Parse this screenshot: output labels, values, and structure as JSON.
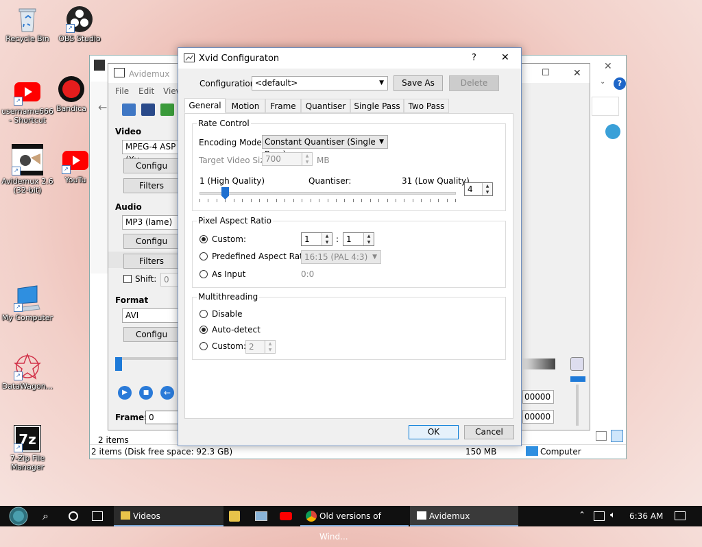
{
  "desktop": {
    "icons": [
      {
        "label": "Recycle Bin"
      },
      {
        "label": "OBS Studio"
      },
      {
        "label": "username666 - Shortcut"
      },
      {
        "label": "Bandica"
      },
      {
        "label": "Avidemux 2.6 (32-bit)"
      },
      {
        "label": "YouTu"
      },
      {
        "label": "My Computer"
      },
      {
        "label": "DataWagon..."
      },
      {
        "label": "7-Zip File Manager"
      }
    ]
  },
  "explorer": {
    "items_count": "2 items",
    "status_left": "2 items (Disk free space: 92.3 GB)",
    "status_size": "150 MB",
    "status_location": "Computer"
  },
  "avidemux": {
    "title": "Avidemux",
    "menu": [
      "File",
      "Edit",
      "View"
    ],
    "video_label": "Video",
    "video_codec": "MPEG-4 ASP (Xv",
    "configure": "Configu",
    "filters": "Filters",
    "audio_label": "Audio",
    "audio_codec": "MP3 (lame)",
    "shift_label": "Shift:",
    "shift_value": "0",
    "format_label": "Format",
    "format_value": "AVI",
    "frame_label": "Frame:",
    "frame_value": "0",
    "time_a": "00000",
    "time_b": "00000"
  },
  "dialog": {
    "title": "Xvid Configuraton",
    "help": "?",
    "close": "✕",
    "configuration_label": "Configuration:",
    "configuration_value": "<default>",
    "save_as": "Save As",
    "delete": "Delete",
    "tabs": [
      "General",
      "Motion",
      "Frame",
      "Quantiser",
      "Single Pass",
      "Two Pass"
    ],
    "rate_control": {
      "title": "Rate Control",
      "encoding_mode_label": "Encoding Mode:",
      "encoding_mode_value": "Constant Quantiser (Single Pass)",
      "target_size_label": "Target Video Size:",
      "target_size_value": "700",
      "target_size_unit": "MB",
      "high_quality": "1 (High Quality)",
      "quantiser_label": "Quantiser:",
      "low_quality": "31 (Low Quality)",
      "quantiser_value": "4",
      "slider_fraction": 0.1
    },
    "pixel_aspect": {
      "title": "Pixel Aspect Ratio",
      "custom_label": "Custom:",
      "custom_num": "1",
      "colon": ":",
      "custom_den": "1",
      "predefined_label": "Predefined Aspect Ratio:",
      "predefined_value": "16:15 (PAL 4:3)",
      "as_input_label": "As Input",
      "as_input_value": "0:0"
    },
    "multithreading": {
      "title": "Multithreading",
      "disable_label": "Disable",
      "auto_label": "Auto-detect",
      "custom_label": "Custom:",
      "custom_value": "2"
    },
    "ok": "OK",
    "cancel": "Cancel"
  },
  "taskbar": {
    "videos": "Videos",
    "chrome": "Old versions of Wind...",
    "avidemux": "Avidemux",
    "time": "6:36 AM"
  }
}
